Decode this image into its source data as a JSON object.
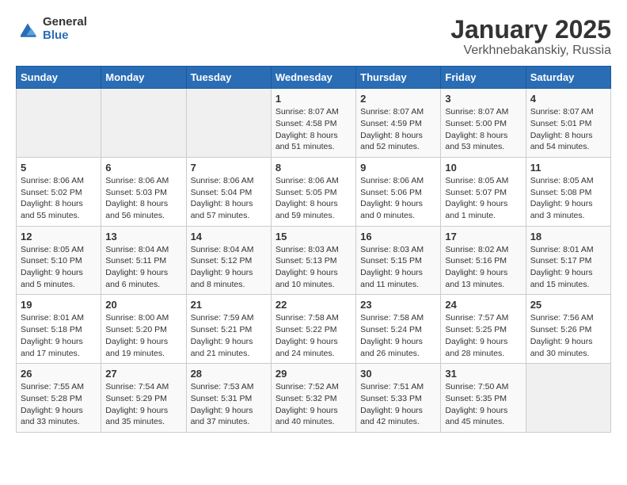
{
  "logo": {
    "general": "General",
    "blue": "Blue"
  },
  "title": "January 2025",
  "subtitle": "Verkhnebakanskiy, Russia",
  "weekdays": [
    "Sunday",
    "Monday",
    "Tuesday",
    "Wednesday",
    "Thursday",
    "Friday",
    "Saturday"
  ],
  "weeks": [
    [
      {
        "num": "",
        "info": ""
      },
      {
        "num": "",
        "info": ""
      },
      {
        "num": "",
        "info": ""
      },
      {
        "num": "1",
        "info": "Sunrise: 8:07 AM\nSunset: 4:58 PM\nDaylight: 8 hours and 51 minutes."
      },
      {
        "num": "2",
        "info": "Sunrise: 8:07 AM\nSunset: 4:59 PM\nDaylight: 8 hours and 52 minutes."
      },
      {
        "num": "3",
        "info": "Sunrise: 8:07 AM\nSunset: 5:00 PM\nDaylight: 8 hours and 53 minutes."
      },
      {
        "num": "4",
        "info": "Sunrise: 8:07 AM\nSunset: 5:01 PM\nDaylight: 8 hours and 54 minutes."
      }
    ],
    [
      {
        "num": "5",
        "info": "Sunrise: 8:06 AM\nSunset: 5:02 PM\nDaylight: 8 hours and 55 minutes."
      },
      {
        "num": "6",
        "info": "Sunrise: 8:06 AM\nSunset: 5:03 PM\nDaylight: 8 hours and 56 minutes."
      },
      {
        "num": "7",
        "info": "Sunrise: 8:06 AM\nSunset: 5:04 PM\nDaylight: 8 hours and 57 minutes."
      },
      {
        "num": "8",
        "info": "Sunrise: 8:06 AM\nSunset: 5:05 PM\nDaylight: 8 hours and 59 minutes."
      },
      {
        "num": "9",
        "info": "Sunrise: 8:06 AM\nSunset: 5:06 PM\nDaylight: 9 hours and 0 minutes."
      },
      {
        "num": "10",
        "info": "Sunrise: 8:05 AM\nSunset: 5:07 PM\nDaylight: 9 hours and 1 minute."
      },
      {
        "num": "11",
        "info": "Sunrise: 8:05 AM\nSunset: 5:08 PM\nDaylight: 9 hours and 3 minutes."
      }
    ],
    [
      {
        "num": "12",
        "info": "Sunrise: 8:05 AM\nSunset: 5:10 PM\nDaylight: 9 hours and 5 minutes."
      },
      {
        "num": "13",
        "info": "Sunrise: 8:04 AM\nSunset: 5:11 PM\nDaylight: 9 hours and 6 minutes."
      },
      {
        "num": "14",
        "info": "Sunrise: 8:04 AM\nSunset: 5:12 PM\nDaylight: 9 hours and 8 minutes."
      },
      {
        "num": "15",
        "info": "Sunrise: 8:03 AM\nSunset: 5:13 PM\nDaylight: 9 hours and 10 minutes."
      },
      {
        "num": "16",
        "info": "Sunrise: 8:03 AM\nSunset: 5:15 PM\nDaylight: 9 hours and 11 minutes."
      },
      {
        "num": "17",
        "info": "Sunrise: 8:02 AM\nSunset: 5:16 PM\nDaylight: 9 hours and 13 minutes."
      },
      {
        "num": "18",
        "info": "Sunrise: 8:01 AM\nSunset: 5:17 PM\nDaylight: 9 hours and 15 minutes."
      }
    ],
    [
      {
        "num": "19",
        "info": "Sunrise: 8:01 AM\nSunset: 5:18 PM\nDaylight: 9 hours and 17 minutes."
      },
      {
        "num": "20",
        "info": "Sunrise: 8:00 AM\nSunset: 5:20 PM\nDaylight: 9 hours and 19 minutes."
      },
      {
        "num": "21",
        "info": "Sunrise: 7:59 AM\nSunset: 5:21 PM\nDaylight: 9 hours and 21 minutes."
      },
      {
        "num": "22",
        "info": "Sunrise: 7:58 AM\nSunset: 5:22 PM\nDaylight: 9 hours and 24 minutes."
      },
      {
        "num": "23",
        "info": "Sunrise: 7:58 AM\nSunset: 5:24 PM\nDaylight: 9 hours and 26 minutes."
      },
      {
        "num": "24",
        "info": "Sunrise: 7:57 AM\nSunset: 5:25 PM\nDaylight: 9 hours and 28 minutes."
      },
      {
        "num": "25",
        "info": "Sunrise: 7:56 AM\nSunset: 5:26 PM\nDaylight: 9 hours and 30 minutes."
      }
    ],
    [
      {
        "num": "26",
        "info": "Sunrise: 7:55 AM\nSunset: 5:28 PM\nDaylight: 9 hours and 33 minutes."
      },
      {
        "num": "27",
        "info": "Sunrise: 7:54 AM\nSunset: 5:29 PM\nDaylight: 9 hours and 35 minutes."
      },
      {
        "num": "28",
        "info": "Sunrise: 7:53 AM\nSunset: 5:31 PM\nDaylight: 9 hours and 37 minutes."
      },
      {
        "num": "29",
        "info": "Sunrise: 7:52 AM\nSunset: 5:32 PM\nDaylight: 9 hours and 40 minutes."
      },
      {
        "num": "30",
        "info": "Sunrise: 7:51 AM\nSunset: 5:33 PM\nDaylight: 9 hours and 42 minutes."
      },
      {
        "num": "31",
        "info": "Sunrise: 7:50 AM\nSunset: 5:35 PM\nDaylight: 9 hours and 45 minutes."
      },
      {
        "num": "",
        "info": ""
      }
    ]
  ]
}
